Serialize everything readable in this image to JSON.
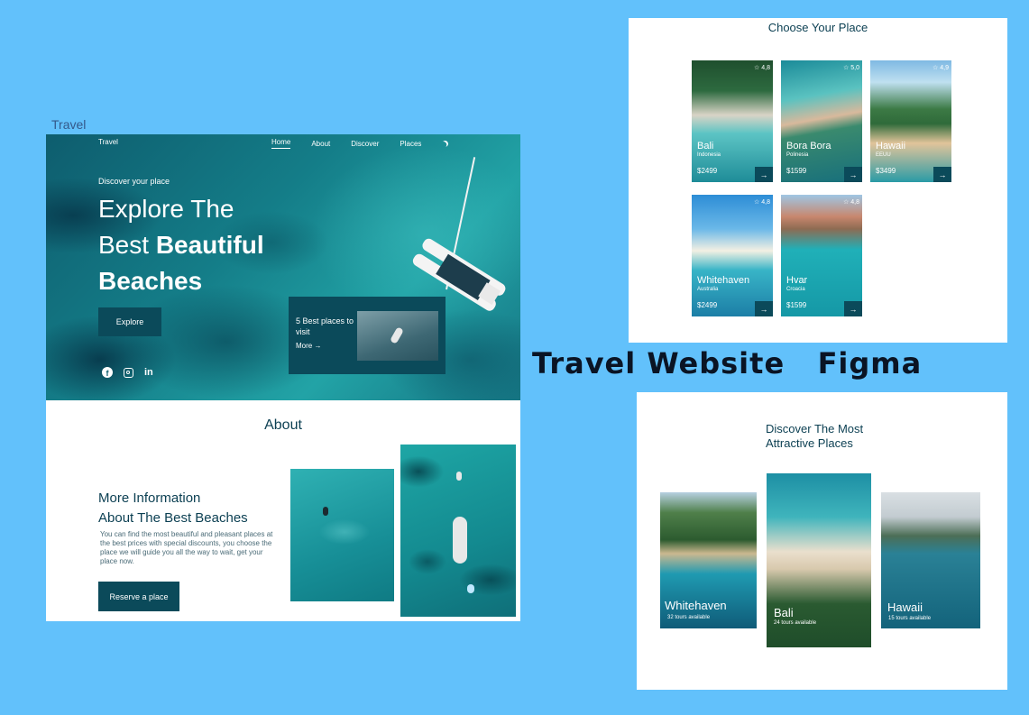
{
  "frame_label": "Travel",
  "colors": {
    "background": "#62c1fb",
    "accent": "#0b4a5a",
    "heading": "#0b3f52"
  },
  "hero": {
    "logo": "Travel",
    "nav": [
      "Home",
      "About",
      "Discover",
      "Places"
    ],
    "theme_icon": "moon-icon",
    "subtitle": "Discover your place",
    "title_line1": "Explore The",
    "title_line2a": "Best ",
    "title_line2b": "Beautiful",
    "title_line3": "Beaches",
    "explore_label": "Explore",
    "socials": [
      "facebook-icon",
      "instagram-icon",
      "linkedin-icon"
    ],
    "card_title": "5 Best places to visit",
    "card_more": "More"
  },
  "about": {
    "title": "About",
    "heading_line1": "More Information",
    "heading_line2": "About The Best Beaches",
    "text": "You can find the most beautiful and pleasant places at the best prices with special discounts, you choose the place we will guide you all the way to wait, get your place now.",
    "button": "Reserve a place"
  },
  "choose": {
    "title": "Choose Your Place",
    "cards": [
      {
        "name": "Bali",
        "country": "Indonesia",
        "price": "$2499",
        "rating": "4,8"
      },
      {
        "name": "Bora Bora",
        "country": "Polinesia",
        "price": "$1599",
        "rating": "5,0"
      },
      {
        "name": "Hawaii",
        "country": "EEUU",
        "price": "$3499",
        "rating": "4,9"
      },
      {
        "name": "Whitehaven",
        "country": "Australia",
        "price": "$2499",
        "rating": "4,8"
      },
      {
        "name": "Hvar",
        "country": "Croacia",
        "price": "$1599",
        "rating": "4,8"
      }
    ]
  },
  "big_title": "Travel Website   Figma",
  "discover": {
    "title": "Discover The Most Attractive Places",
    "cards": [
      {
        "name": "Whitehaven",
        "tours": "32 tours available"
      },
      {
        "name": "Bali",
        "tours": "24 tours available"
      },
      {
        "name": "Hawaii",
        "tours": "15 tours available"
      }
    ]
  }
}
